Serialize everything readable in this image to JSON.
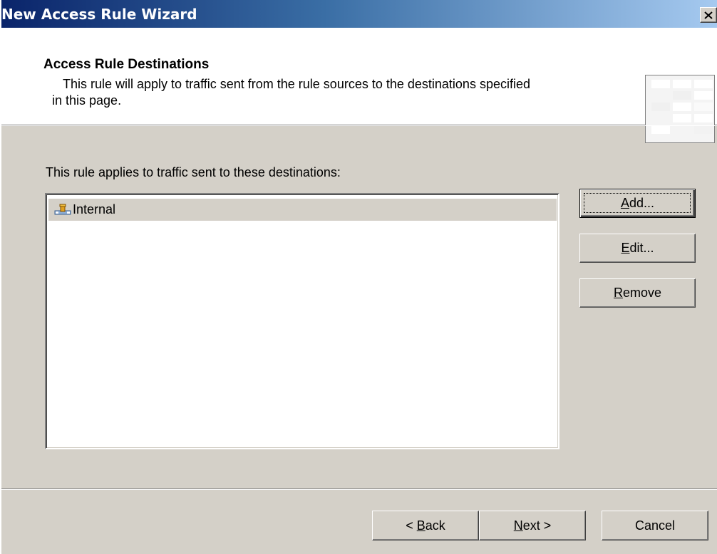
{
  "window": {
    "title": "New Access Rule Wizard",
    "close_glyph": "✕"
  },
  "header": {
    "title": "Access Rule Destinations",
    "description_line1": "This rule will apply to traffic sent from the rule sources to the destinations specified",
    "description_line2": "in this page."
  },
  "content": {
    "label": "This rule applies to traffic sent to these destinations:",
    "destinations": [
      {
        "label": "Internal",
        "icon": "network-icon",
        "selected": true
      }
    ]
  },
  "side_buttons": {
    "add": {
      "pre": "",
      "accel": "A",
      "post": "dd..."
    },
    "edit": {
      "pre": "",
      "accel": "E",
      "post": "dit..."
    },
    "remove": {
      "pre": "",
      "accel": "R",
      "post": "emove"
    }
  },
  "footer": {
    "back": {
      "pre": "< ",
      "accel": "B",
      "post": "ack"
    },
    "next": {
      "pre": "",
      "accel": "N",
      "post": "ext >"
    },
    "cancel": {
      "label": "Cancel"
    }
  },
  "colors": {
    "title_gradient_start": "#0a246a",
    "title_gradient_end": "#a6caf0",
    "dialog_face": "#d4d0c8",
    "header_bg": "#ffffff"
  }
}
